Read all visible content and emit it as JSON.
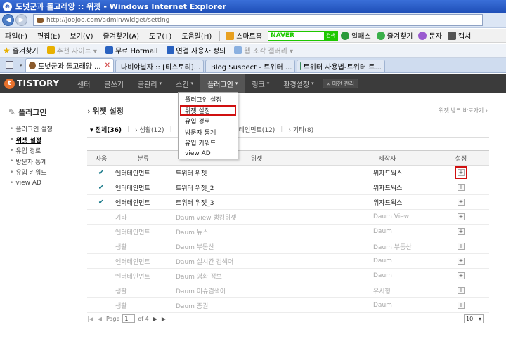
{
  "window": {
    "title": "도넛군과 돌고래양 :: 위젯 - Windows Internet Explorer"
  },
  "address": {
    "url": "http://joojoo.com/admin/widget/setting"
  },
  "menubar": {
    "items": [
      "파일(F)",
      "편집(E)",
      "보기(V)",
      "즐겨찾기(A)",
      "도구(T)",
      "도움말(H)"
    ],
    "smarthome": "스마트홈",
    "naver_logo": "NAVER",
    "naver_go": "검색",
    "alpass": "알패스",
    "favorites": "즐겨찾기",
    "msg": "문자",
    "capture": "캡쳐"
  },
  "favbar": {
    "label": "즐겨찾기",
    "items": [
      "추천 사이트 ▾",
      "무료 Hotmail",
      "연결 사용자 정의",
      "웹 조각 갤러리 ▾"
    ]
  },
  "tabs": [
    {
      "label": "도넛군과 돌고래양 ...",
      "active": true
    },
    {
      "label": "나비야날자 :: [티스토리]...",
      "active": false
    },
    {
      "label": "Blog Suspect - 트위터 ...",
      "active": false
    },
    {
      "label": "트위터 사용법-트위터 트...",
      "active": false
    }
  ],
  "tistory": {
    "logo": "TISTORY",
    "nav": [
      "센터",
      "글쓰기",
      "글관리",
      "스킨",
      "플러그인",
      "링크",
      "환경설정"
    ],
    "prev": "« 이전 관리"
  },
  "sidebar": {
    "title": "플러그인",
    "items": [
      "플러그인 설정",
      "위젯 설정",
      "유입 경로",
      "방문자 통계",
      "유입 키워드",
      "view AD"
    ],
    "active_index": 1
  },
  "dropdown": {
    "items": [
      "플러그인 설정",
      "위젯 설정",
      "유입 경로",
      "방문자 통계",
      "유입 키워드",
      "view AD"
    ],
    "highlight_index": 1
  },
  "main": {
    "title": "위젯 설정",
    "shortcut": "위젯 뱅크 바로가기 ›",
    "filters": [
      "전체(36)",
      "생활(12)",
      "시계",
      "엔터테인먼트(12)",
      "기타(8)"
    ]
  },
  "table": {
    "headers": [
      "사용",
      "분류",
      "위젯",
      "제작자",
      "설정"
    ],
    "rows": [
      {
        "use": "✔",
        "cat": "엔터테인먼트",
        "name": "트위터 위젯",
        "maker": "위자드웍스",
        "on": true,
        "hl": true
      },
      {
        "use": "✔",
        "cat": "엔터테인먼트",
        "name": "트위터 위젯_2",
        "maker": "위자드웍스",
        "on": true
      },
      {
        "use": "✔",
        "cat": "엔터테인먼트",
        "name": "트위터 위젯_3",
        "maker": "위자드웍스",
        "on": true
      },
      {
        "use": "",
        "cat": "기타",
        "name": "Daum view 랭킹위젯",
        "maker": "Daum View",
        "on": false
      },
      {
        "use": "",
        "cat": "엔터테인먼트",
        "name": "Daum 뉴스",
        "maker": "Daum",
        "on": false
      },
      {
        "use": "",
        "cat": "생활",
        "name": "Daum 부동산",
        "maker": "Daum 부동산",
        "on": false
      },
      {
        "use": "",
        "cat": "엔터테인먼트",
        "name": "Daum 실시간 검색어",
        "maker": "Daum",
        "on": false
      },
      {
        "use": "",
        "cat": "엔터테인먼트",
        "name": "Daum 영화 정보",
        "maker": "Daum",
        "on": false
      },
      {
        "use": "",
        "cat": "생활",
        "name": "Daum 이슈검색어",
        "maker": "유시형",
        "on": false
      },
      {
        "use": "",
        "cat": "생활",
        "name": "Daum 증권",
        "maker": "Daum",
        "on": false
      }
    ]
  },
  "pager": {
    "page_label": "Page",
    "page_value": "1",
    "of_label": "of 4",
    "page_size": "10"
  }
}
